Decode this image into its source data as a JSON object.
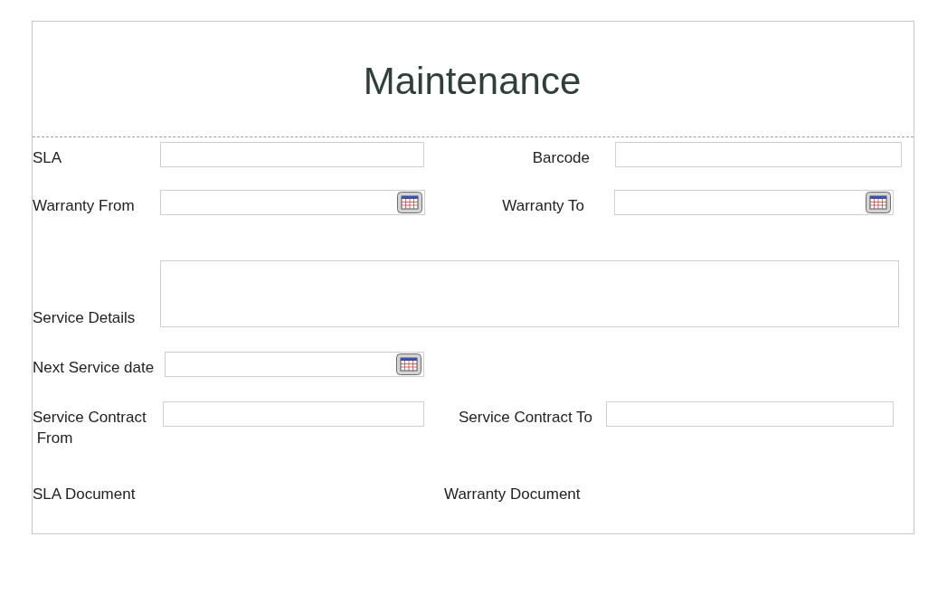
{
  "form": {
    "title": "Maintenance",
    "fields": [
      {
        "label": "SLA",
        "kind": "text"
      },
      {
        "label": "Barcode",
        "kind": "text"
      },
      {
        "label": "Warranty From",
        "kind": "date"
      },
      {
        "label": "Warranty To",
        "kind": "date"
      },
      {
        "label": "Service Details",
        "kind": "textarea"
      },
      {
        "label": "Next Service date",
        "kind": "date"
      },
      {
        "label": "Service Contract\n From",
        "kind": "text"
      },
      {
        "label": "Service Contract To",
        "kind": "text"
      },
      {
        "label": "SLA Document"
      },
      {
        "label": "Warranty Document"
      }
    ]
  }
}
